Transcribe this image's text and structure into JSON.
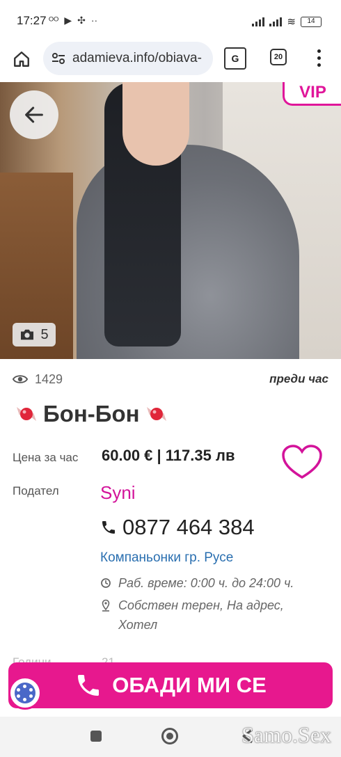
{
  "status_bar": {
    "time": "17:27",
    "battery": "14"
  },
  "browser": {
    "url": "adamieva.info/obiava-",
    "translate_label": "G",
    "tab_count": "20"
  },
  "photo": {
    "vip_label": "VIP",
    "photo_count": "5"
  },
  "listing": {
    "views": "1429",
    "posted": "преди час",
    "title": "Бон-Бон",
    "price_label": "Цена за час",
    "price": "60.00 € | 117.35 лв",
    "poster_label": "Подател",
    "poster_name": "Syni",
    "phone": "0877 464 384",
    "category": "Компаньонки гр. Русе",
    "work_hours": "Раб. време: 0:00 ч. до 24:00 ч.",
    "location_line1": "Собствен терен, На адрес,",
    "location_line2": "Хотел",
    "faded_label": "Години",
    "faded_value": "21"
  },
  "call_button": {
    "label": "ОБАДИ МИ СЕ"
  },
  "watermark": "Samo.Sex",
  "colors": {
    "accent": "#e7188e",
    "poster": "#d3139a",
    "link": "#2a6fb0"
  }
}
